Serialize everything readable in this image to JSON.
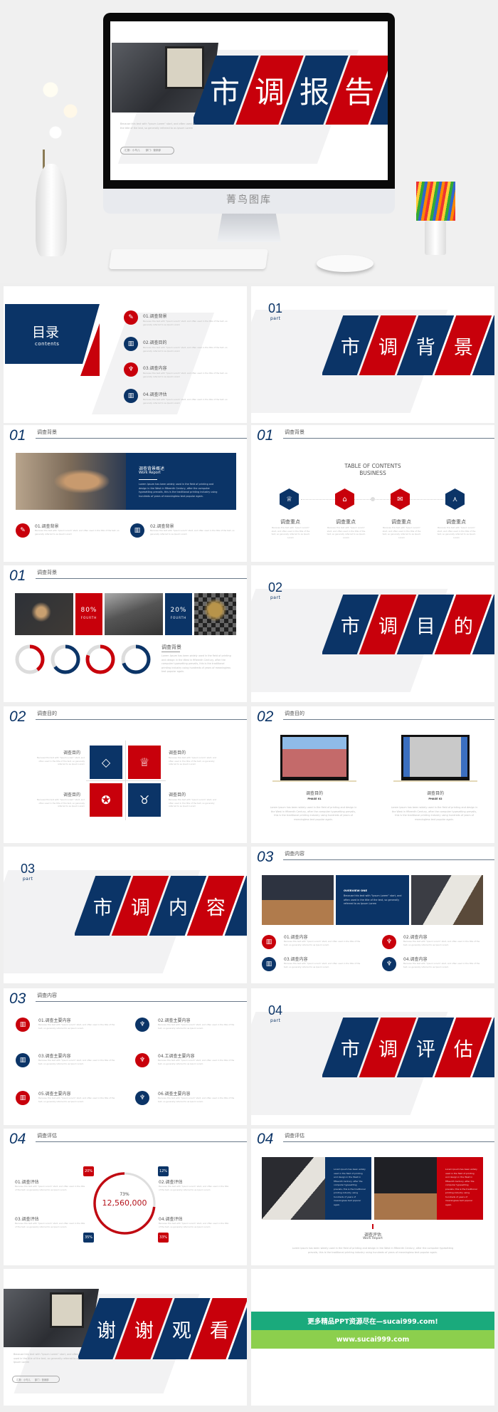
{
  "colors": {
    "navy": "#0b3467",
    "red": "#c8000b",
    "green": "#1aaa7c",
    "lime": "#8ccf4d"
  },
  "lorem": "Because this text with \"Ipsum Lorem\" start, and often used in the title of the text, so generally referred to as Ipsum Lorem",
  "lorem_long": "Lorem Ipsum has been widely used in the field of printing and design in the West in fifteenth Century, after the computer typesetting prevails, this is the traditional printing industry using hundreds of years of meaningless text popular again.",
  "hero": {
    "title_chars": [
      "市",
      "调",
      "报",
      "告"
    ],
    "monitor_brand": "菁鸟图库",
    "reporter": "汇报：小鸟儿",
    "department": "部门：营销部"
  },
  "toc": {
    "title": "目录",
    "subtitle": "contents",
    "items": [
      "01.调查背景",
      "02.调查目的",
      "03.调查内容",
      "04.调查评估"
    ]
  },
  "parts": [
    {
      "num": "01",
      "label": "part",
      "chars": [
        "市",
        "调",
        "背",
        "景"
      ]
    },
    {
      "num": "02",
      "label": "part",
      "chars": [
        "市",
        "调",
        "目",
        "的"
      ]
    },
    {
      "num": "03",
      "label": "part",
      "chars": [
        "市",
        "调",
        "内",
        "容"
      ]
    },
    {
      "num": "04",
      "label": "part",
      "chars": [
        "市",
        "调",
        "评",
        "估"
      ]
    }
  ],
  "sections": {
    "s1": {
      "num": "01",
      "label": "调查背景"
    },
    "s2": {
      "num": "02",
      "label": "调查目的"
    },
    "s3": {
      "num": "03",
      "label": "调查内容"
    },
    "s4": {
      "num": "04",
      "label": "调查评估"
    }
  },
  "bg_overview": {
    "title": "调查背景概述",
    "subtitle": "Work Report",
    "items": [
      "01.调查背景",
      "02.调查背景"
    ]
  },
  "toc_business": {
    "title1": "TABLE OF CONTENTS",
    "title2": "BUSINESS",
    "items": [
      "调查重点",
      "调查重点",
      "调查重点",
      "调查重点"
    ]
  },
  "stats": {
    "stat1": "80%",
    "stat1_label": "FOURTH",
    "stat2": "20%",
    "stat2_label": "FOURTH",
    "heading": "调查背景",
    "donuts": [
      {
        "percent": 40,
        "color": "red"
      },
      {
        "percent": 65,
        "color": "navy"
      },
      {
        "percent": 80,
        "color": "red"
      },
      {
        "percent": 70,
        "color": "navy"
      }
    ]
  },
  "purpose_quad": {
    "items": [
      "调查目的",
      "调查目的",
      "调查目的",
      "调查目的"
    ]
  },
  "purpose_phases": [
    {
      "title": "调查目的",
      "phase": "PHASE 01"
    },
    {
      "title": "调查目的",
      "phase": "PHASE 02"
    }
  ],
  "content_overview": {
    "title": "OVERVIEW ONE",
    "items": [
      "01.调查内容",
      "02.调查内容",
      "03.调查内容",
      "04.调查内容"
    ]
  },
  "content_main": {
    "items": [
      "01.调查主要内容",
      "02.调查主要内容",
      "03.调查主要内容",
      "04.工调查主要内容",
      "05.调查主要内容",
      "06.调查主要内容"
    ]
  },
  "evaluation": {
    "ring_percent": 73,
    "ring_label": "73%",
    "total": "12,560,000",
    "badges": [
      "20%",
      "12%",
      "35%",
      "33%"
    ],
    "items": [
      "01.调查评估",
      "02.调查评估",
      "03.调查评估",
      "04.调查评估"
    ]
  },
  "evaluation_report": {
    "title": "调查评估",
    "subtitle": "Work Report"
  },
  "thanks": {
    "chars": [
      "谢",
      "谢",
      "观",
      "看"
    ],
    "reporter": "汇报：小鸟儿",
    "department": "部门：营销部"
  },
  "promo": {
    "line1": "更多精品PPT资源尽在—sucai999.com!",
    "line2": "www.sucai999.com"
  }
}
